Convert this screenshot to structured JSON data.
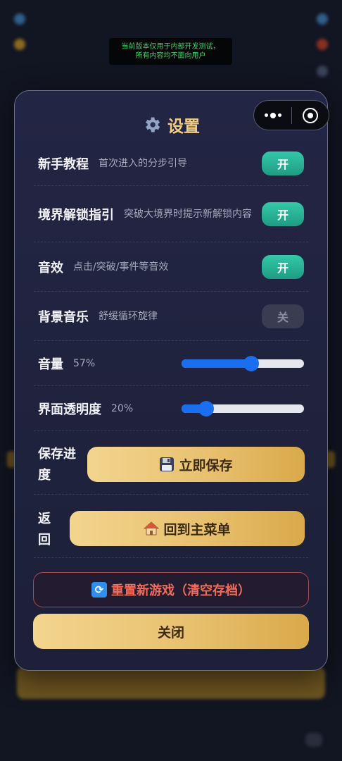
{
  "dev_notice": {
    "line1": "当前版本仅用于内部开发测试，",
    "line2": "所有内容均不面向用户"
  },
  "dialog": {
    "title": "设置",
    "title_icon": "gear-icon",
    "settings": [
      {
        "key": "tutorial",
        "label": "新手教程",
        "desc": "首次进入的分步引导",
        "state": "开",
        "on": true
      },
      {
        "key": "realm_guide",
        "label": "境界解锁指引",
        "desc": "突破大境界时提示新解锁内容",
        "state": "开",
        "on": true
      },
      {
        "key": "sfx",
        "label": "音效",
        "desc": "点击/突破/事件等音效",
        "state": "开",
        "on": true
      },
      {
        "key": "bgm",
        "label": "背景音乐",
        "desc": "舒缓循环旋律",
        "state": "关",
        "on": false
      }
    ],
    "volume": {
      "label": "音量",
      "value_text": "57%",
      "value": 57
    },
    "ui_opacity": {
      "label": "界面透明度",
      "value_text": "20%",
      "value": 20
    },
    "save": {
      "label": "保存进度",
      "button": "立即保存",
      "icon": "floppy-disk-icon"
    },
    "back": {
      "label": "返回",
      "button": "回到主菜单",
      "icon": "house-icon"
    },
    "reset_button": "重置新游戏（清空存档）",
    "reset_icon": "refresh-icon",
    "close_button": "关闭"
  },
  "colors": {
    "accent_gold": "#f0cd82",
    "toggle_on": "#2bb397",
    "slider_blue": "#1a6ef0",
    "danger_red": "#ef6c5a"
  }
}
